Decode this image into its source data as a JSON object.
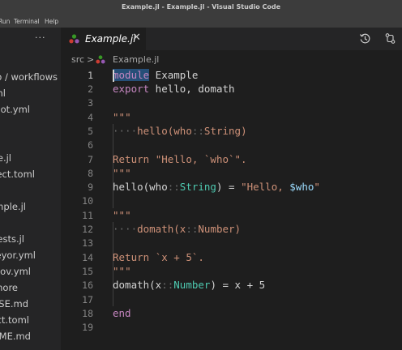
{
  "window": {
    "title": "Example.jl - Example.jl - Visual Studio Code"
  },
  "menu": {
    "items": [
      "Run",
      "Terminal",
      "Help"
    ]
  },
  "sidebar": {
    "more_label": "···",
    "items": [
      "b / workflows",
      "ml",
      "Bot.yml",
      "e.jl",
      "ect.toml",
      "mple.jl",
      "ests.jl",
      "eyor.yml",
      "cov.yml",
      "nore",
      "SE.md",
      "ct.toml",
      "ME.md"
    ]
  },
  "tab": {
    "name": "Example.jl",
    "close": "✕"
  },
  "breadcrumb": {
    "folder": "src",
    "sep": ">",
    "file": "Example.jl"
  },
  "editor": {
    "line_numbers": [
      "1",
      "2",
      "3",
      "4",
      "5",
      "6",
      "7",
      "8",
      "9",
      "10",
      "11",
      "12",
      "13",
      "14",
      "15",
      "16",
      "17",
      "18",
      "19"
    ],
    "current_line": 1,
    "lines": [
      "module Example",
      "export hello, domath",
      "",
      "\"\"\"",
      "    hello(who::String)",
      "",
      "Return \"Hello, `who`\".",
      "\"\"\"",
      "hello(who::String) = \"Hello, $who\"",
      "",
      "\"\"\"",
      "    domath(x::Number)",
      "",
      "Return `x + 5`.",
      "\"\"\"",
      "domath(x::Number) = x + 5",
      "",
      "end",
      ""
    ]
  },
  "colors": {
    "background": "#1e1e1e",
    "sidebar": "#252526",
    "titlebar": "#3c3c3c",
    "keyword": "#c586c0",
    "string": "#ce9178",
    "type": "#4ec9b0",
    "variable": "#9cdcfe",
    "julia_red": "#cb3c33",
    "julia_green": "#389826",
    "julia_purple": "#9558b2"
  },
  "icons": [
    "julia-logo-icon",
    "close-icon",
    "timeline-icon",
    "compare-changes-icon",
    "more-actions-icon"
  ]
}
